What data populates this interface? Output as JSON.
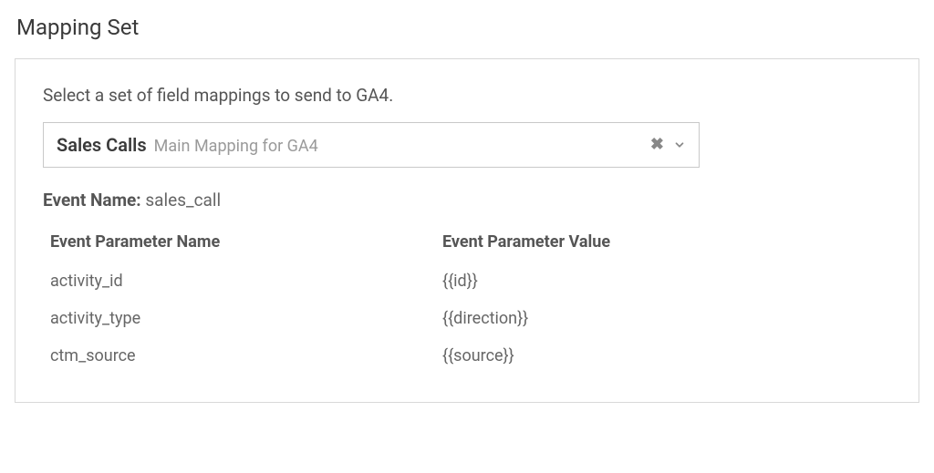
{
  "section_title": "Mapping Set",
  "instruction": "Select a set of field mappings to send to GA4.",
  "select": {
    "primary": "Sales Calls",
    "secondary": "Main Mapping for GA4"
  },
  "event": {
    "label": "Event Name:",
    "value": "sales_call"
  },
  "table": {
    "headers": {
      "name": "Event Parameter Name",
      "value": "Event Parameter Value"
    },
    "rows": [
      {
        "name": "activity_id",
        "value": "{{id}}"
      },
      {
        "name": "activity_type",
        "value": "{{direction}}"
      },
      {
        "name": "ctm_source",
        "value": "{{source}}"
      }
    ]
  }
}
